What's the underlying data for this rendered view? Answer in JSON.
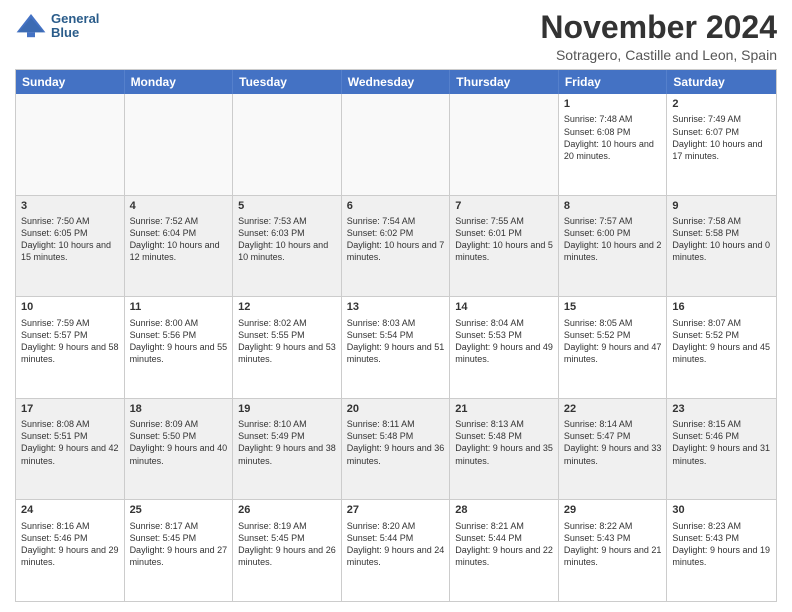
{
  "header": {
    "logo_line1": "General",
    "logo_line2": "Blue",
    "month_title": "November 2024",
    "location": "Sotragero, Castille and Leon, Spain"
  },
  "days_of_week": [
    "Sunday",
    "Monday",
    "Tuesday",
    "Wednesday",
    "Thursday",
    "Friday",
    "Saturday"
  ],
  "weeks": [
    [
      {
        "day": "",
        "empty": true
      },
      {
        "day": "",
        "empty": true
      },
      {
        "day": "",
        "empty": true
      },
      {
        "day": "",
        "empty": true
      },
      {
        "day": "",
        "empty": true
      },
      {
        "day": "1",
        "sunrise": "Sunrise: 7:48 AM",
        "sunset": "Sunset: 6:08 PM",
        "daylight": "Daylight: 10 hours and 20 minutes."
      },
      {
        "day": "2",
        "sunrise": "Sunrise: 7:49 AM",
        "sunset": "Sunset: 6:07 PM",
        "daylight": "Daylight: 10 hours and 17 minutes."
      }
    ],
    [
      {
        "day": "3",
        "sunrise": "Sunrise: 7:50 AM",
        "sunset": "Sunset: 6:05 PM",
        "daylight": "Daylight: 10 hours and 15 minutes."
      },
      {
        "day": "4",
        "sunrise": "Sunrise: 7:52 AM",
        "sunset": "Sunset: 6:04 PM",
        "daylight": "Daylight: 10 hours and 12 minutes."
      },
      {
        "day": "5",
        "sunrise": "Sunrise: 7:53 AM",
        "sunset": "Sunset: 6:03 PM",
        "daylight": "Daylight: 10 hours and 10 minutes."
      },
      {
        "day": "6",
        "sunrise": "Sunrise: 7:54 AM",
        "sunset": "Sunset: 6:02 PM",
        "daylight": "Daylight: 10 hours and 7 minutes."
      },
      {
        "day": "7",
        "sunrise": "Sunrise: 7:55 AM",
        "sunset": "Sunset: 6:01 PM",
        "daylight": "Daylight: 10 hours and 5 minutes."
      },
      {
        "day": "8",
        "sunrise": "Sunrise: 7:57 AM",
        "sunset": "Sunset: 6:00 PM",
        "daylight": "Daylight: 10 hours and 2 minutes."
      },
      {
        "day": "9",
        "sunrise": "Sunrise: 7:58 AM",
        "sunset": "Sunset: 5:58 PM",
        "daylight": "Daylight: 10 hours and 0 minutes."
      }
    ],
    [
      {
        "day": "10",
        "sunrise": "Sunrise: 7:59 AM",
        "sunset": "Sunset: 5:57 PM",
        "daylight": "Daylight: 9 hours and 58 minutes."
      },
      {
        "day": "11",
        "sunrise": "Sunrise: 8:00 AM",
        "sunset": "Sunset: 5:56 PM",
        "daylight": "Daylight: 9 hours and 55 minutes."
      },
      {
        "day": "12",
        "sunrise": "Sunrise: 8:02 AM",
        "sunset": "Sunset: 5:55 PM",
        "daylight": "Daylight: 9 hours and 53 minutes."
      },
      {
        "day": "13",
        "sunrise": "Sunrise: 8:03 AM",
        "sunset": "Sunset: 5:54 PM",
        "daylight": "Daylight: 9 hours and 51 minutes."
      },
      {
        "day": "14",
        "sunrise": "Sunrise: 8:04 AM",
        "sunset": "Sunset: 5:53 PM",
        "daylight": "Daylight: 9 hours and 49 minutes."
      },
      {
        "day": "15",
        "sunrise": "Sunrise: 8:05 AM",
        "sunset": "Sunset: 5:52 PM",
        "daylight": "Daylight: 9 hours and 47 minutes."
      },
      {
        "day": "16",
        "sunrise": "Sunrise: 8:07 AM",
        "sunset": "Sunset: 5:52 PM",
        "daylight": "Daylight: 9 hours and 45 minutes."
      }
    ],
    [
      {
        "day": "17",
        "sunrise": "Sunrise: 8:08 AM",
        "sunset": "Sunset: 5:51 PM",
        "daylight": "Daylight: 9 hours and 42 minutes."
      },
      {
        "day": "18",
        "sunrise": "Sunrise: 8:09 AM",
        "sunset": "Sunset: 5:50 PM",
        "daylight": "Daylight: 9 hours and 40 minutes."
      },
      {
        "day": "19",
        "sunrise": "Sunrise: 8:10 AM",
        "sunset": "Sunset: 5:49 PM",
        "daylight": "Daylight: 9 hours and 38 minutes."
      },
      {
        "day": "20",
        "sunrise": "Sunrise: 8:11 AM",
        "sunset": "Sunset: 5:48 PM",
        "daylight": "Daylight: 9 hours and 36 minutes."
      },
      {
        "day": "21",
        "sunrise": "Sunrise: 8:13 AM",
        "sunset": "Sunset: 5:48 PM",
        "daylight": "Daylight: 9 hours and 35 minutes."
      },
      {
        "day": "22",
        "sunrise": "Sunrise: 8:14 AM",
        "sunset": "Sunset: 5:47 PM",
        "daylight": "Daylight: 9 hours and 33 minutes."
      },
      {
        "day": "23",
        "sunrise": "Sunrise: 8:15 AM",
        "sunset": "Sunset: 5:46 PM",
        "daylight": "Daylight: 9 hours and 31 minutes."
      }
    ],
    [
      {
        "day": "24",
        "sunrise": "Sunrise: 8:16 AM",
        "sunset": "Sunset: 5:46 PM",
        "daylight": "Daylight: 9 hours and 29 minutes."
      },
      {
        "day": "25",
        "sunrise": "Sunrise: 8:17 AM",
        "sunset": "Sunset: 5:45 PM",
        "daylight": "Daylight: 9 hours and 27 minutes."
      },
      {
        "day": "26",
        "sunrise": "Sunrise: 8:19 AM",
        "sunset": "Sunset: 5:45 PM",
        "daylight": "Daylight: 9 hours and 26 minutes."
      },
      {
        "day": "27",
        "sunrise": "Sunrise: 8:20 AM",
        "sunset": "Sunset: 5:44 PM",
        "daylight": "Daylight: 9 hours and 24 minutes."
      },
      {
        "day": "28",
        "sunrise": "Sunrise: 8:21 AM",
        "sunset": "Sunset: 5:44 PM",
        "daylight": "Daylight: 9 hours and 22 minutes."
      },
      {
        "day": "29",
        "sunrise": "Sunrise: 8:22 AM",
        "sunset": "Sunset: 5:43 PM",
        "daylight": "Daylight: 9 hours and 21 minutes."
      },
      {
        "day": "30",
        "sunrise": "Sunrise: 8:23 AM",
        "sunset": "Sunset: 5:43 PM",
        "daylight": "Daylight: 9 hours and 19 minutes."
      }
    ]
  ]
}
